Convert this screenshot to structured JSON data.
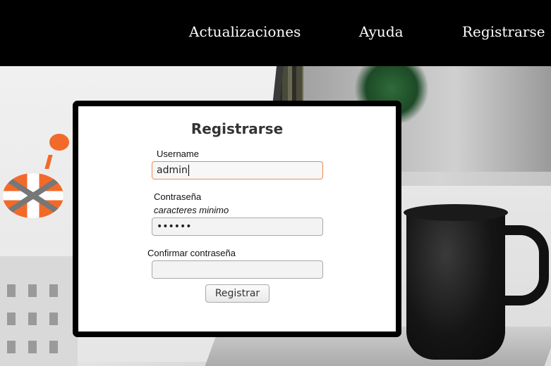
{
  "nav": {
    "items": [
      {
        "label": "Actualizaciones"
      },
      {
        "label": "Ayuda"
      },
      {
        "label": "Registrarse"
      }
    ]
  },
  "form": {
    "title": "Registrarse",
    "username_label": "Username",
    "username_value": "admin",
    "password_label": "Contraseña",
    "password_hint": "caracteres minimo",
    "password_value": "••••••",
    "confirm_label": "Confirmar contraseña",
    "confirm_value": "",
    "submit_label": "Registrar"
  },
  "colors": {
    "nav_bg": "#000000",
    "focus_border": "#e88d52",
    "accent": "#f26a2a"
  }
}
